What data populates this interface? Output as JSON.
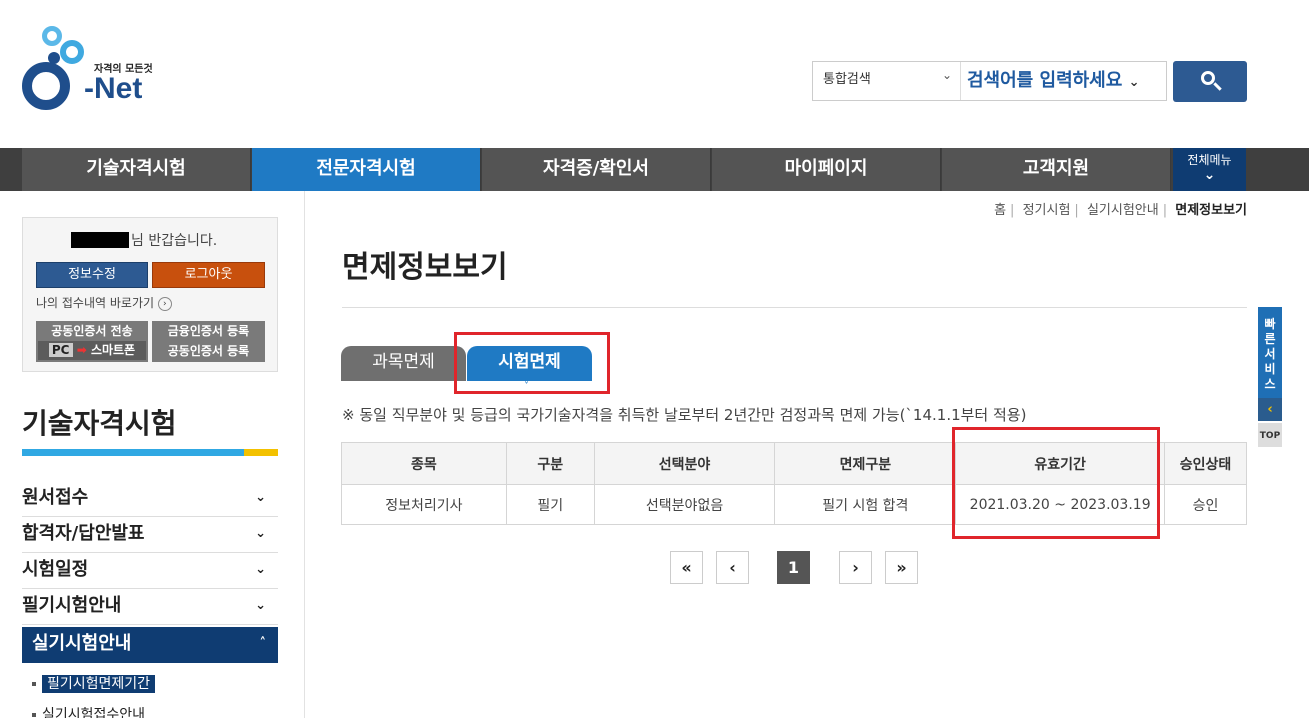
{
  "header": {
    "logo_tagline": "자격의 모든것",
    "logo_text": "-Net",
    "logo_letter": "Q",
    "search_scope": "통합검색",
    "search_placeholder": "검색어를 입력하세요"
  },
  "nav": {
    "items": [
      "기술자격시험",
      "전문자격시험",
      "자격증/확인서",
      "마이페이지",
      "고객지원"
    ],
    "active_index": 1,
    "all_menu_label": "전체메뉴"
  },
  "login": {
    "greeting": "님 반갑습니다.",
    "edit_label": "정보수정",
    "logout_label": "로그아웃",
    "receipt_link": "나의 접수내역 바로가기",
    "cert_send_line1": "공동인증서 전송",
    "cert_send_pc": "PC",
    "cert_send_phone": "스마트폰",
    "cert_register_line1": "금융인증서 등록",
    "cert_register_line2": "공동인증서 등록"
  },
  "sidebar": {
    "title": "기술자격시험",
    "menu": [
      {
        "label": "원서접수"
      },
      {
        "label": "합격자/답안발표"
      },
      {
        "label": "시험일정"
      },
      {
        "label": "필기시험안내"
      },
      {
        "label": "실기시험안내"
      }
    ],
    "submenu": [
      {
        "label": "필기시험면제기간"
      },
      {
        "label": "실기시험접수안내"
      }
    ]
  },
  "breadcrumb": [
    "홈",
    "정기시험",
    "실기시험안내",
    "면제정보보기"
  ],
  "page": {
    "title": "면제정보보기",
    "tabs": [
      "과목면제",
      "시험면제"
    ],
    "active_tab": 1,
    "notice": "※ 동일 직무분야 및 등급의 국가기술자격을 취득한 날로부터 2년간만 검정과목 면제 가능(`14.1.1부터 적용)"
  },
  "table": {
    "headers": [
      "종목",
      "구분",
      "선택분야",
      "면제구분",
      "유효기간",
      "승인상태"
    ],
    "rows": [
      [
        "정보처리기사",
        "필기",
        "선택분야없음",
        "필기 시험 합격",
        "2021.03.20 ~ 2023.03.19",
        "승인"
      ]
    ]
  },
  "pagination": {
    "first": "«",
    "prev": "‹",
    "current": "1",
    "next": "›",
    "last": "»"
  },
  "quick_service": {
    "label": "빠른서비스",
    "top_label": "TOP"
  },
  "colors": {
    "brand_blue": "#1f7ac4",
    "navy": "#0f3c72",
    "highlight_red": "#e0252b",
    "logout_orange": "#c8500d"
  }
}
